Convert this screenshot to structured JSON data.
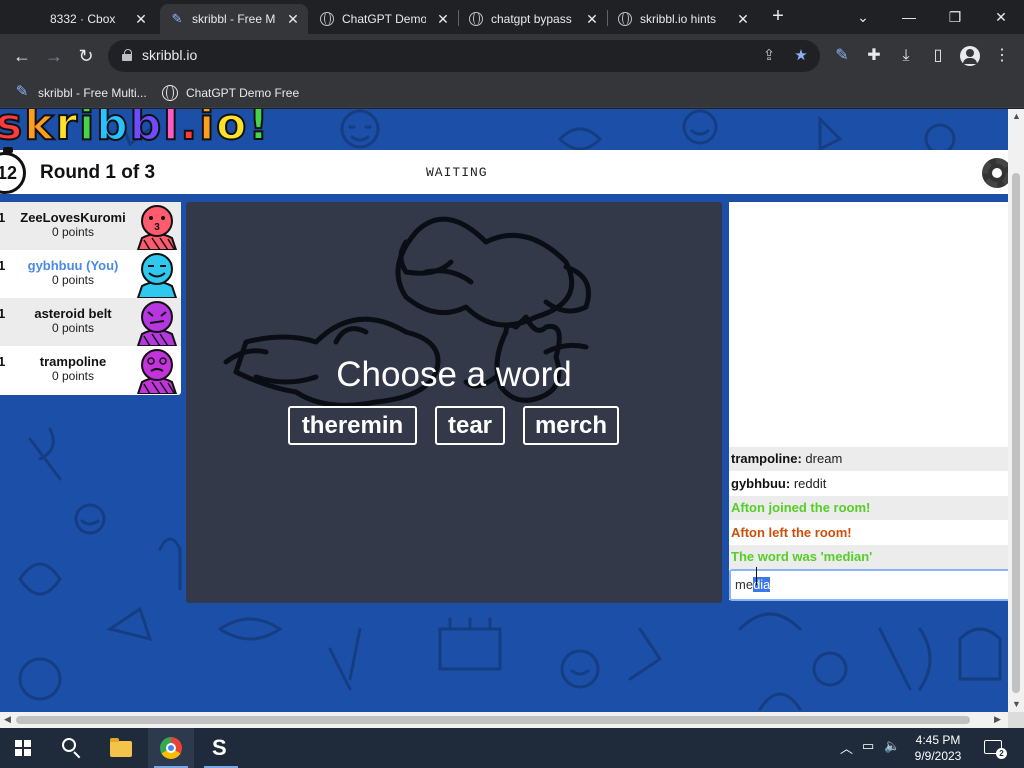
{
  "browser": {
    "tabs": [
      {
        "label": "8332 · Cbox"
      },
      {
        "label": "skribbl - Free Multiplayer Drawing & Guessing Game"
      },
      {
        "label": "ChatGPT Demo Free"
      },
      {
        "label": "chatgpt bypass"
      },
      {
        "label": "skribbl.io hints"
      }
    ],
    "url": "skribbl.io",
    "bookmarks": [
      {
        "label": "skribbl - Free Multi..."
      },
      {
        "label": "ChatGPT Demo Free"
      }
    ]
  },
  "game": {
    "timer": "12",
    "round": "Round 1 of 3",
    "status": "WAITING",
    "players": [
      {
        "rank": "1",
        "name": "ZeeLovesKuromi",
        "points": "0 points",
        "avatar_color": "#ff5b6e"
      },
      {
        "rank": "1",
        "name": "gybhbuu (You)",
        "points": "0 points",
        "avatar_color": "#2ec8f0"
      },
      {
        "rank": "1",
        "name": "asteroid belt",
        "points": "0 points",
        "avatar_color": "#b636e0"
      },
      {
        "rank": "1",
        "name": "trampoline",
        "points": "0 points",
        "avatar_color": "#c233dc"
      }
    ],
    "prompt": "Choose a word",
    "words": [
      "theremin",
      "tear",
      "merch"
    ]
  },
  "chat": {
    "messages": [
      {
        "user": "trampoline:",
        "text": "dream"
      },
      {
        "user": "gybhbuu:",
        "text": "reddit"
      },
      {
        "text": "Afton joined the room!"
      },
      {
        "text": "Afton left the room!"
      },
      {
        "text": "The word was 'median'"
      }
    ],
    "input_plain": "me",
    "input_selected": "dia"
  },
  "taskbar": {
    "time": "4:45 PM",
    "date": "9/9/2023",
    "notification_count": "2"
  }
}
